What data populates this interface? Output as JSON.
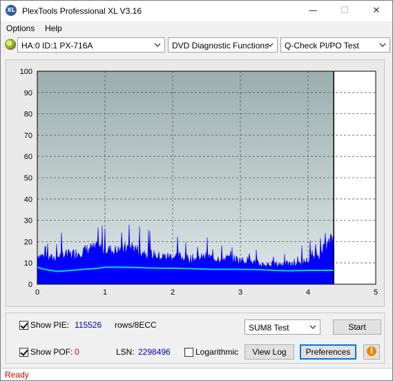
{
  "window": {
    "title": "PlexTools Professional XL V3.16",
    "icon_text": "XL"
  },
  "window_controls": {
    "minimize": "—",
    "maximize": "☐",
    "close": "✕"
  },
  "menu": {
    "options": "Options",
    "help": "Help"
  },
  "toolbar": {
    "drive": "HA:0 ID:1  PX-716A",
    "function": "DVD Diagnostic Functions",
    "test": "Q-Check PI/PO Test"
  },
  "chart_data": {
    "type": "area",
    "xlim": [
      0,
      5
    ],
    "ylim": [
      0,
      100
    ],
    "x_ticks": [
      "0",
      "1",
      "2",
      "3",
      "4",
      "5"
    ],
    "y_ticks": [
      "0",
      "10",
      "20",
      "30",
      "40",
      "50",
      "60",
      "70",
      "80",
      "90",
      "100"
    ],
    "grid": true,
    "data_end_x": 4.38,
    "colors": {
      "pie": "#0000ff",
      "avg": "#00e0e0",
      "bg": "#a8b8b8"
    },
    "series": [
      {
        "values_x": [
          0,
          0.1,
          0.2,
          0.3,
          0.4,
          0.5,
          0.6,
          0.7,
          0.8,
          0.9,
          1.0,
          1.1,
          1.2,
          1.3,
          1.4,
          1.5,
          1.6,
          1.7,
          1.8,
          1.9,
          2.0,
          2.1,
          2.2,
          2.3,
          2.4,
          2.5,
          2.6,
          2.7,
          2.8,
          2.9,
          3.0,
          3.1,
          3.2,
          3.3,
          3.4,
          3.5,
          3.6,
          3.7,
          3.8,
          3.9,
          4.0,
          4.1,
          4.2,
          4.3,
          4.38
        ],
        "values_y": [
          15,
          14,
          13,
          14,
          15,
          15,
          16,
          17,
          18,
          18,
          18,
          17,
          17,
          18,
          19,
          17,
          16,
          15,
          14,
          14,
          14,
          14,
          13,
          13,
          13,
          14,
          13,
          13,
          13,
          13,
          12,
          12,
          11,
          10,
          10,
          10,
          10,
          10,
          10,
          11,
          12,
          14,
          16,
          20,
          24
        ]
      },
      {
        "values_x": [
          0,
          0.1,
          0.2,
          0.3,
          0.5,
          0.7,
          0.9,
          1.0,
          1.2,
          1.5,
          1.8,
          2.0,
          2.3,
          2.6,
          3.0,
          3.3,
          3.5,
          3.7,
          4.0,
          4.2,
          4.38
        ],
        "values_y": [
          8,
          7,
          6.5,
          6,
          6.5,
          7,
          7.5,
          8,
          8,
          7.8,
          7.5,
          7.5,
          7.3,
          7,
          7,
          6.8,
          6.5,
          6.3,
          6.5,
          6.5,
          6.5
        ]
      }
    ]
  },
  "bottom": {
    "show_pie_label": "Show PIE:",
    "pie_value": "115526",
    "pie_unit": "rows/8ECC",
    "show_pof_label": "Show POF:",
    "pof_value": "0",
    "lsn_label": "LSN:",
    "lsn_value": "2298496",
    "logarithmic_label": "Logarithmic",
    "test_select": "SUM8 Test",
    "start_label": "Start",
    "view_log_label": "View Log",
    "preferences_label": "Preferences",
    "info_icon": "i"
  },
  "status": {
    "text": "Ready"
  }
}
